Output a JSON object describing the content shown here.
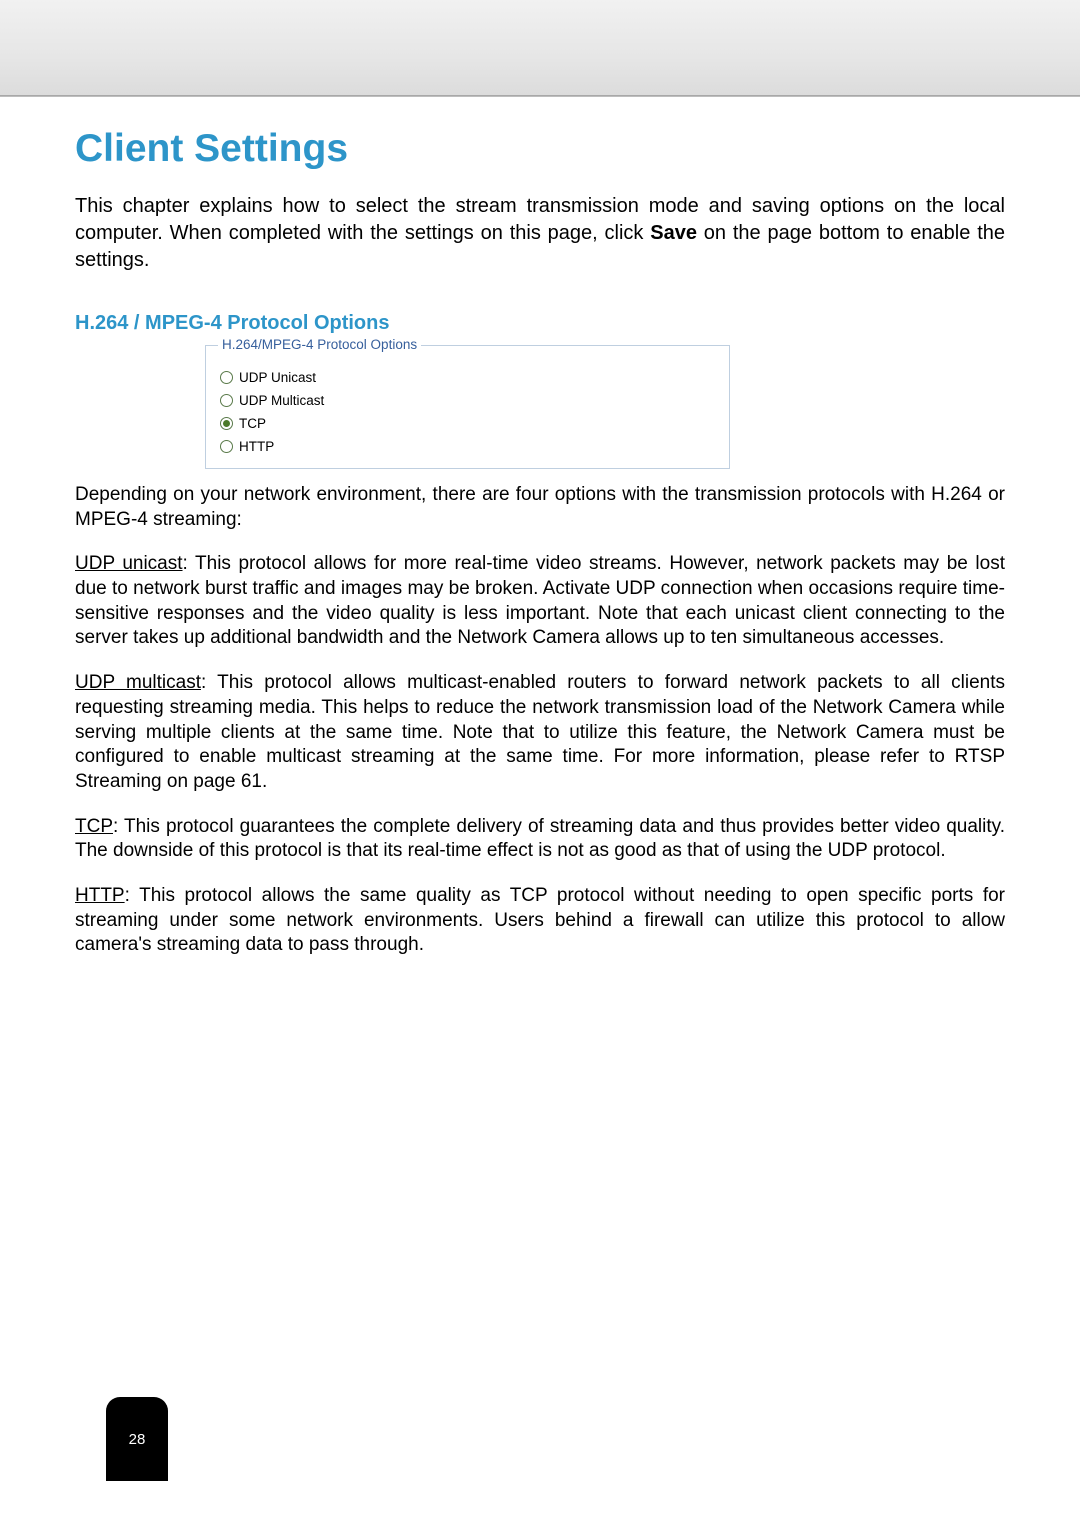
{
  "header": {
    "title": "Client Settings"
  },
  "intro": {
    "pre": "This chapter explains how to select the stream transmission mode and saving options on the local computer. When completed with the settings on this page, click ",
    "bold": "Save",
    "post": " on the page bottom to enable the settings."
  },
  "section": {
    "heading": "H.264 / MPEG-4 Protocol Options",
    "fieldset_legend": "H.264/MPEG-4 Protocol Options",
    "options": [
      {
        "label": "UDP Unicast",
        "checked": false
      },
      {
        "label": "UDP Multicast",
        "checked": false
      },
      {
        "label": "TCP",
        "checked": true
      },
      {
        "label": "HTTP",
        "checked": false
      }
    ]
  },
  "paragraphs": {
    "lead": "Depending on your network environment, there are four options with the transmission protocols with H.264 or MPEG-4 streaming:",
    "udp_unicast": {
      "term": "UDP unicast",
      "text": ": This protocol allows for more real-time video streams. However, network packets may be lost due to network burst traffic and images may be broken. Activate UDP connection when occasions require time-sensitive responses and the video quality is less important. Note that each unicast client connecting to the server takes up additional bandwidth and the Network Camera allows up to ten simultaneous accesses."
    },
    "udp_multicast": {
      "term": "UDP multicast",
      "text": ": This protocol allows multicast-enabled routers to forward network packets to all clients requesting streaming media. This helps to reduce the network transmission load of the Network Camera while serving multiple clients at the same time. Note that to utilize this feature, the Network Camera must be configured to enable multicast streaming at the same time. For more information, please refer to RTSP Streaming on page 61."
    },
    "tcp": {
      "term": "TCP",
      "text": ": This protocol guarantees the complete delivery of streaming data and thus provides better video quality. The downside of this protocol is that its real-time effect is not as good as that of using the UDP protocol."
    },
    "http": {
      "term": "HTTP",
      "text": ": This protocol allows the same quality as TCP protocol without needing to open specific ports for streaming under some network environments. Users behind a firewall can utilize this protocol to allow camera's streaming data to pass through."
    }
  },
  "page_number": "28"
}
